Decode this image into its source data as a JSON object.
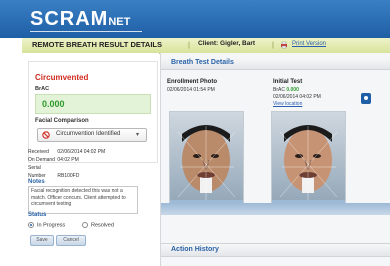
{
  "brand": {
    "name": "SCRAM",
    "suffix": "NET"
  },
  "titlebar": {
    "title": "REMOTE BREATH RESULT DETAILS",
    "client_label": "Client: Gigler, Bart",
    "print_label": "Print Version"
  },
  "status": {
    "title": "Circumvented",
    "brac_label": "BrAC",
    "brac_value": "0.000"
  },
  "facial": {
    "label": "Facial Comparison",
    "value": "Circumvention Identified"
  },
  "info": [
    {
      "key": "Received",
      "value": "02/06/2014 04:02 PM"
    },
    {
      "key": "On Demand",
      "value": "04:02 PM"
    },
    {
      "key": "Serial Number",
      "value": "RB100FD"
    }
  ],
  "notes": {
    "label": "Notes",
    "text": "Facial recognition detected this was not a match. Officer concurs. Client attempted to circumvent testing"
  },
  "status_field": {
    "label": "Status",
    "options": [
      "In Progress",
      "Resolved"
    ],
    "selected": "In Progress"
  },
  "buttons": {
    "save": "Save",
    "cancel": "Cancel"
  },
  "breath_panel": {
    "title": "Breath Test Details",
    "enrollment": {
      "title": "Enrollment Photo",
      "date": "02/06/2014 01:54 PM"
    },
    "initial": {
      "title": "Initial Test",
      "brac_label": "BrAC",
      "brac_value": "0.000",
      "date": "02/06/2014 04:02 PM",
      "link": "View location"
    }
  },
  "action_history": {
    "title": "Action History"
  },
  "colors": {
    "header": "#1f5fa5",
    "alert": "#d02b20",
    "ok": "#2f9a2c",
    "link": "#2a5fb0"
  }
}
